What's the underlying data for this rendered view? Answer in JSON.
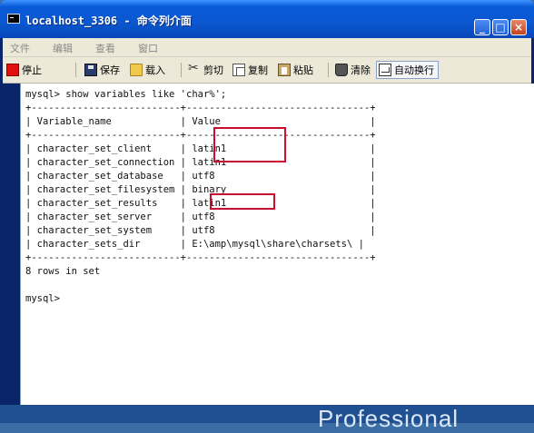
{
  "window": {
    "title": "localhost_3306 - 命令列介面"
  },
  "menu": [
    "文件",
    "编辑",
    "查看",
    "窗口"
  ],
  "toolbar": {
    "stop": "停止",
    "save": "保存",
    "load": "载入",
    "cut": "剪切",
    "copy": "复制",
    "paste": "粘贴",
    "clear": "清除",
    "wrap": "自动换行"
  },
  "console": {
    "command": "mysql> show variables like 'char%';",
    "border": "+--------------------------+--------------------------------+",
    "header": "| Variable_name            | Value                          |",
    "rows": [
      "| character_set_client     | latin1                         |",
      "| character_set_connection | latin1                         |",
      "| character_set_database   | utf8                           |",
      "| character_set_filesystem | binary                         |",
      "| character_set_results    | latin1                         |",
      "| character_set_server     | utf8                           |",
      "| character_set_system     | utf8                           |",
      "| character_sets_dir       | E:\\amp\\mysql\\share\\charsets\\ |"
    ],
    "summary": "8 rows in set",
    "prompt": "mysql>"
  },
  "background_text": "Professional",
  "colors": {
    "titlebar": "#0a57d0",
    "highlight_box": "#c8102e",
    "menu_bg": "#ece9d8"
  }
}
